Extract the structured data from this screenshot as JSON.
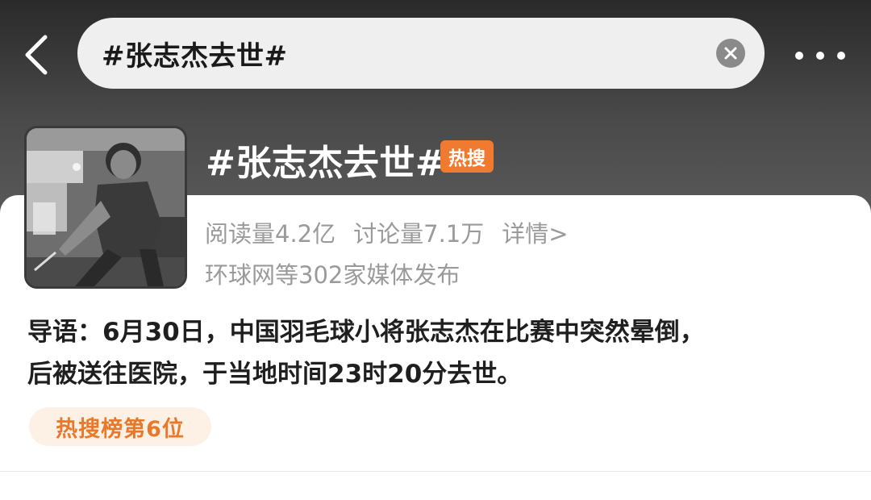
{
  "search": {
    "query": "#张志杰去世#"
  },
  "topic": {
    "title": "#张志杰去世#",
    "badge": "热搜",
    "reads": "阅读量4.2亿",
    "discussions": "讨论量7.1万",
    "details_link": "详情>",
    "media_count": "环球网等302家媒体发布",
    "intro_line1": "导语：6月30日，中国羽毛球小将张志杰在比赛中突然晕倒，",
    "intro_line2": "后被送往医院，于当地时间23时20分去世。",
    "rank": "热搜榜第6位"
  },
  "colors": {
    "accent": "#f07a30",
    "rank_bg": "#fdf1e6",
    "rank_text": "#e8782a"
  },
  "icons": {
    "back": "chevron-left-icon",
    "clear": "close-icon",
    "more": "more-icon"
  }
}
